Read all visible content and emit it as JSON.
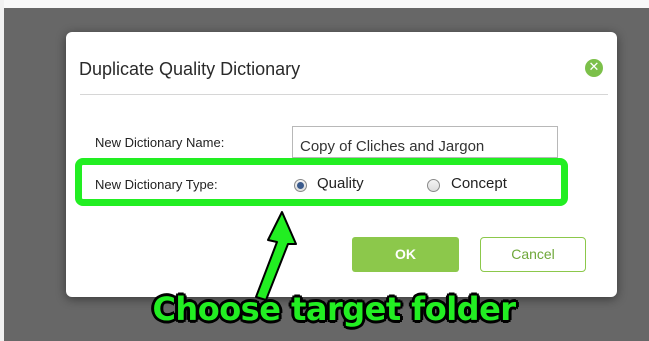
{
  "dialog": {
    "title": "Duplicate Quality Dictionary",
    "close_icon": "close-icon",
    "name_label": "New Dictionary Name:",
    "name_value": "Copy of Cliches and Jargon",
    "type_label": "New Dictionary Type:",
    "type_options": [
      {
        "label": "Quality",
        "checked": true
      },
      {
        "label": "Concept",
        "checked": false
      }
    ],
    "ok_label": "OK",
    "cancel_label": "Cancel"
  },
  "annotation": {
    "text": "Choose target folder",
    "color": "#22ee22"
  },
  "colors": {
    "accent_green": "#8cc84b",
    "overlay": "#676767"
  }
}
